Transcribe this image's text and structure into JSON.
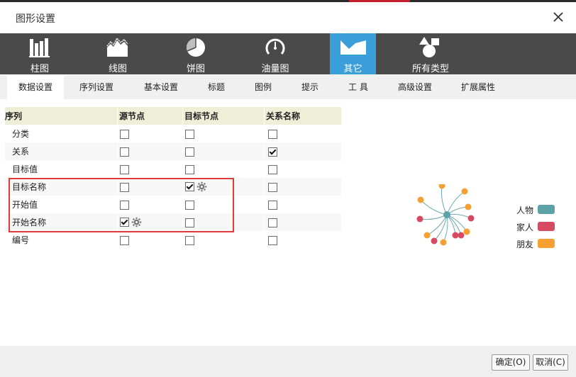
{
  "dialog": {
    "title": "图形设置"
  },
  "chart_types": [
    {
      "label": "柱图",
      "icon": "bar-chart-icon"
    },
    {
      "label": "线图",
      "icon": "line-chart-icon"
    },
    {
      "label": "饼图",
      "icon": "pie-chart-icon"
    },
    {
      "label": "油量图",
      "icon": "gauge-icon"
    },
    {
      "label": "其它",
      "icon": "other-chart-icon",
      "active": true
    },
    {
      "label": "所有类型",
      "icon": "shapes-icon"
    }
  ],
  "sub_tabs": [
    "数据设置",
    "序列设置",
    "基本设置",
    "标题",
    "图例",
    "提示",
    "工 具",
    "高级设置",
    "扩展属性"
  ],
  "table": {
    "headers": [
      "序列",
      "源节点",
      "目标节点",
      "关系名称"
    ],
    "rows": [
      {
        "name": "分类",
        "source": false,
        "target": false,
        "relation": false
      },
      {
        "name": "关系",
        "source": false,
        "target": false,
        "relation": true
      },
      {
        "name": "目标值",
        "source": false,
        "target": false,
        "relation": false
      },
      {
        "name": "目标名称",
        "source": false,
        "target": true,
        "target_gear": true,
        "relation": false
      },
      {
        "name": "开始值",
        "source": false,
        "target": false,
        "relation": false
      },
      {
        "name": "开始名称",
        "source": true,
        "source_gear": true,
        "target": false,
        "relation": false
      },
      {
        "name": "编号",
        "source": false,
        "target": false,
        "relation": false
      }
    ]
  },
  "preview": {
    "legend": [
      {
        "label": "人物",
        "color": "#5ba3a8"
      },
      {
        "label": "家人",
        "color": "#d64a63"
      },
      {
        "label": "朋友",
        "color": "#f5a030"
      }
    ]
  },
  "buttons": {
    "ok": "确定(O)",
    "cancel": "取消(C)"
  }
}
